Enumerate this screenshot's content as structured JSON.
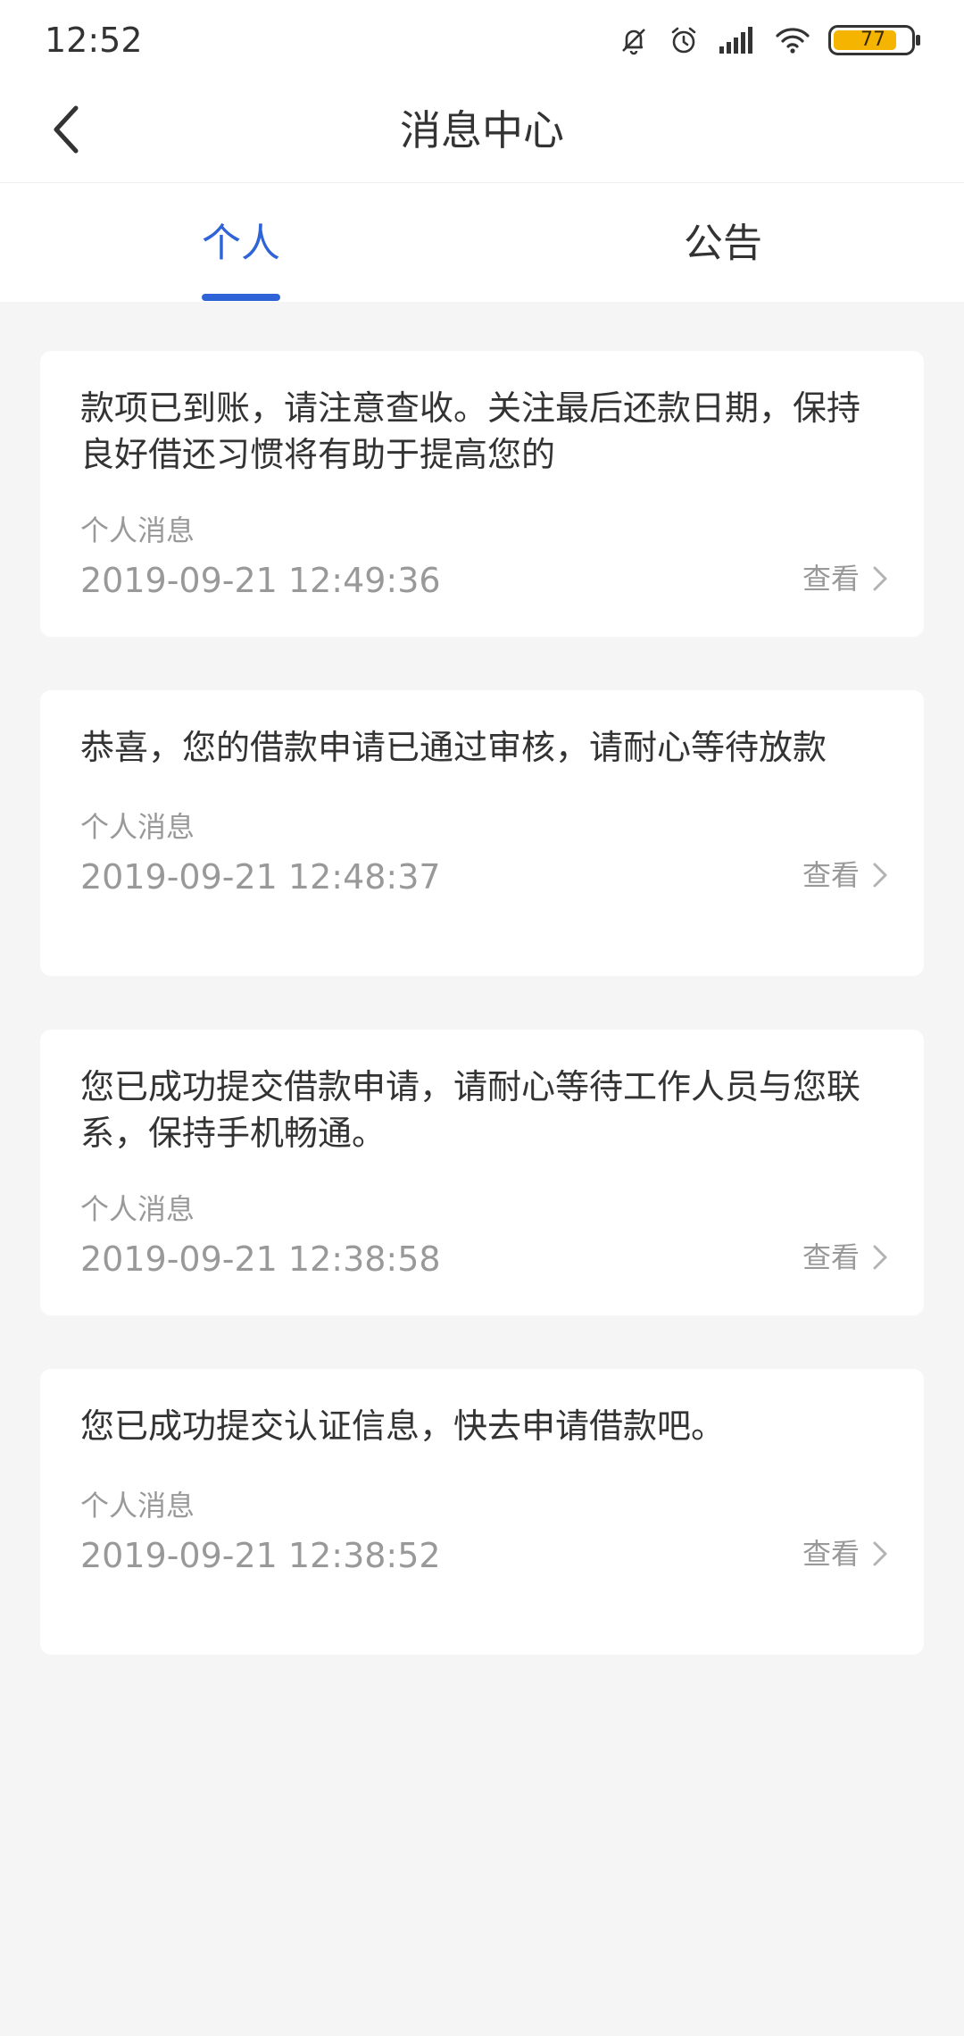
{
  "status_bar": {
    "time": "12:52",
    "battery": "77",
    "icons": [
      "mute-bell-icon",
      "alarm-icon",
      "signal-icon",
      "wifi-icon",
      "battery-icon"
    ]
  },
  "header": {
    "title": "消息中心",
    "back_icon": "chevron-left-icon"
  },
  "tabs": [
    {
      "label": "个人",
      "active": true
    },
    {
      "label": "公告",
      "active": false
    }
  ],
  "messages": [
    {
      "content": "款项已到账，请注意查收。关注最后还款日期，保持良好借还习惯将有助于提高您的",
      "type": "个人消息",
      "time": "2019-09-21 12:49:36",
      "action": "查看"
    },
    {
      "content": "恭喜，您的借款申请已通过审核，请耐心等待放款",
      "type": "个人消息",
      "time": "2019-09-21 12:48:37",
      "action": "查看"
    },
    {
      "content": "您已成功提交借款申请，请耐心等待工作人员与您联系，保持手机畅通。",
      "type": "个人消息",
      "time": "2019-09-21 12:38:58",
      "action": "查看"
    },
    {
      "content": "您已成功提交认证信息，快去申请借款吧。",
      "type": "个人消息",
      "time": "2019-09-21 12:38:52",
      "action": "查看"
    }
  ],
  "colors": {
    "accent": "#2f64d8",
    "background": "#f5f5f6",
    "card": "#ffffff",
    "text": "#333333",
    "muted": "#999999",
    "battery": "#f5b400"
  }
}
